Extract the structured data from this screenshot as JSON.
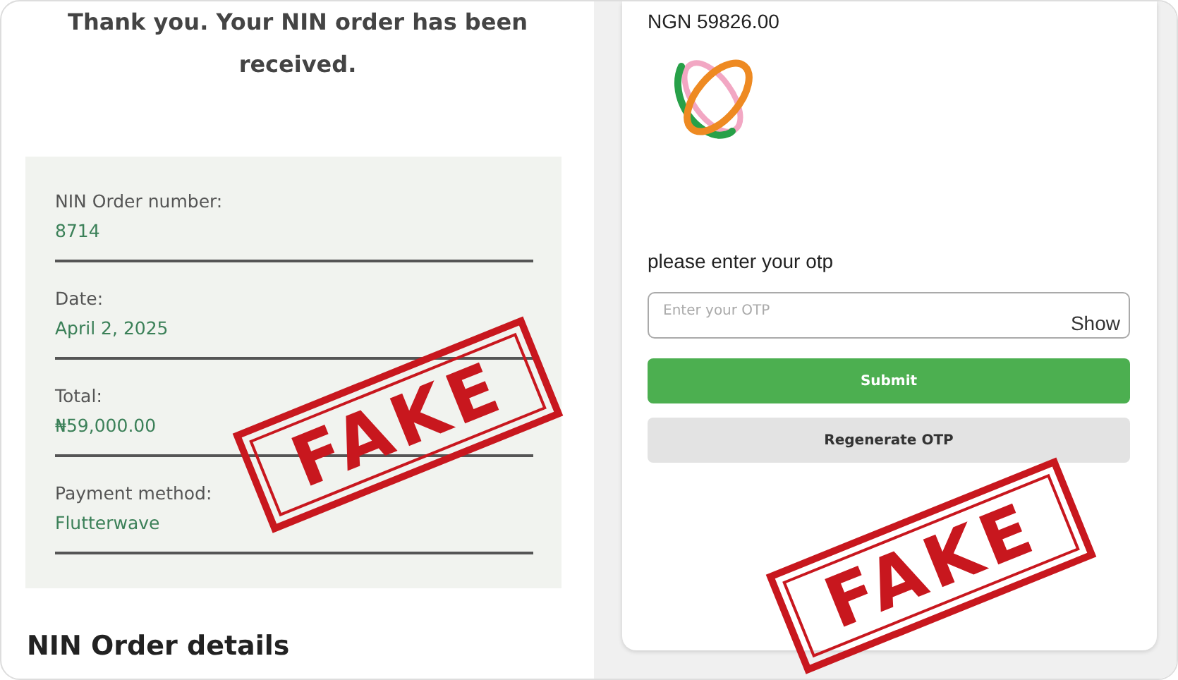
{
  "order_page": {
    "heading": "Thank you. Your NIN order has been received.",
    "summary": [
      {
        "label": "NIN Order number:",
        "value": "8714"
      },
      {
        "label": "Date:",
        "value": "April 2, 2025"
      },
      {
        "label": "Total:",
        "value": "₦59,000.00"
      },
      {
        "label": "Payment method:",
        "value": "Flutterwave"
      }
    ],
    "details_heading": "NIN Order details"
  },
  "payment_page": {
    "amount": "NGN 59826.00",
    "prompt": "please enter your otp",
    "otp_field": {
      "placeholder": "Enter your OTP",
      "toggle": "Show"
    },
    "buttons": [
      {
        "label": "Submit",
        "kind": "primary"
      },
      {
        "label": "Regenerate OTP",
        "kind": "secondary"
      }
    ]
  },
  "stamps": [
    {
      "text": "FAKE"
    },
    {
      "text": "FAKE"
    }
  ]
}
